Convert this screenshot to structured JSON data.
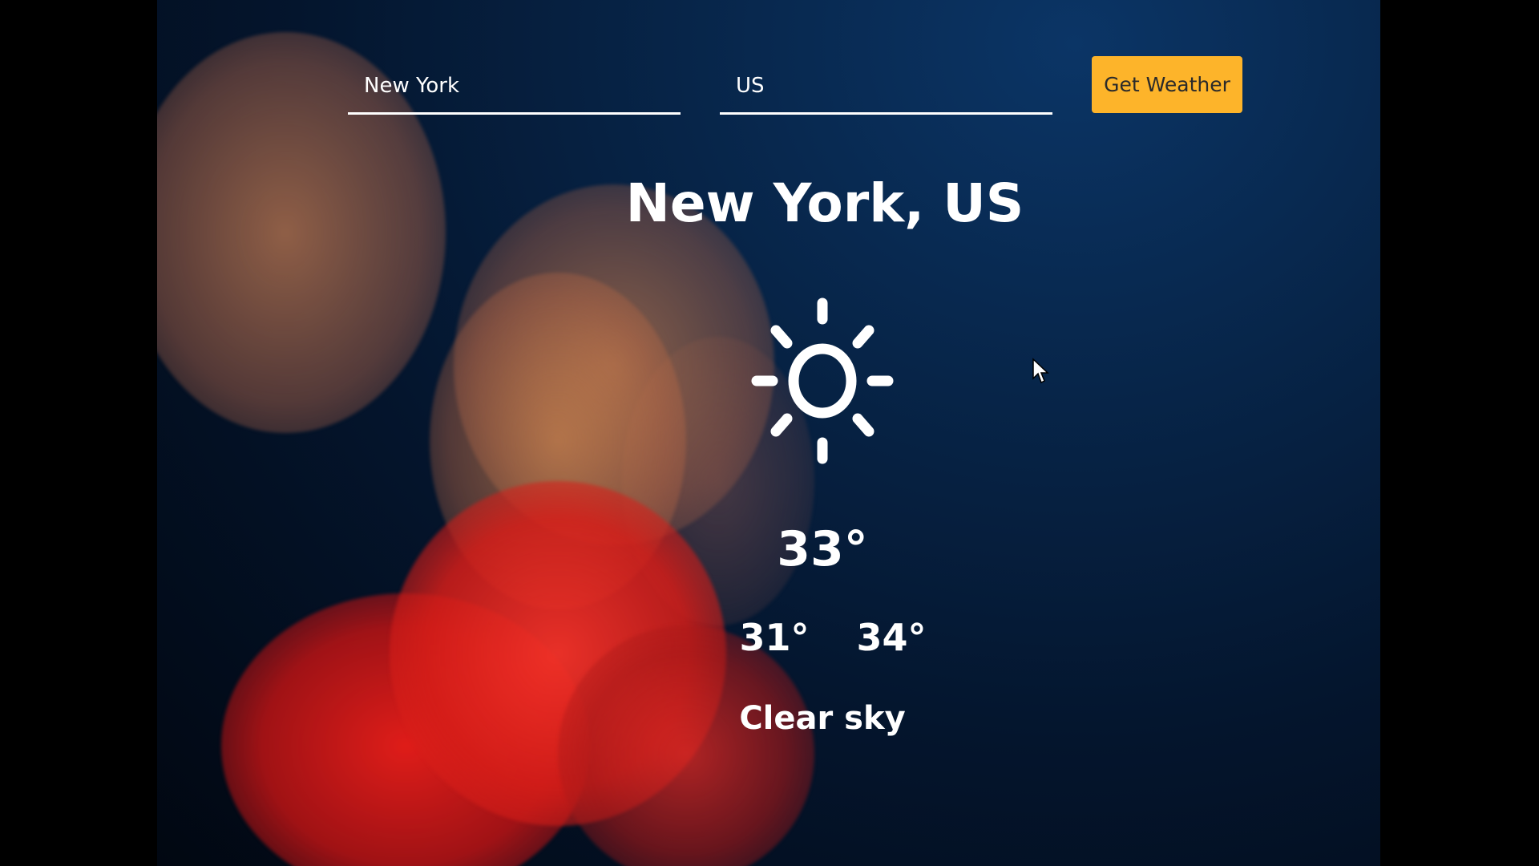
{
  "search": {
    "city_value": "New York",
    "country_value": "US",
    "button_label": "Get Weather"
  },
  "weather": {
    "location": "New York, US",
    "icon": "sun-icon",
    "current_temp": "33°",
    "min_temp": "31°",
    "max_temp": "34°",
    "description": "Clear sky"
  },
  "colors": {
    "accent": "#fdb42a",
    "text": "#ffffff",
    "background_dark": "#04152d"
  }
}
